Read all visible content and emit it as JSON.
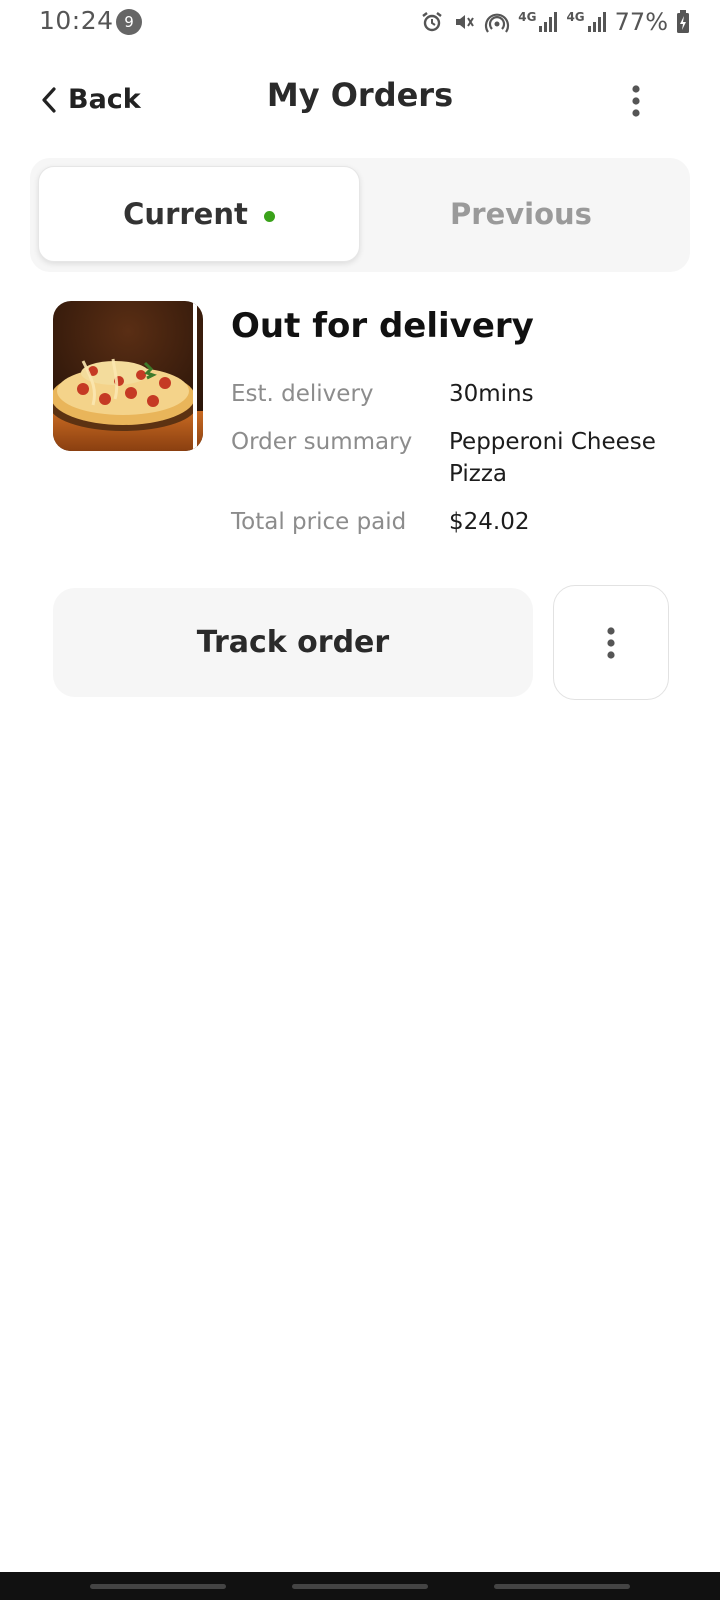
{
  "status_bar": {
    "time": "10:24",
    "notification_count": "9",
    "battery": "77%",
    "network_1": "4G",
    "network_2": "4G"
  },
  "header": {
    "back_label": "Back",
    "title": "My Orders"
  },
  "tabs": [
    {
      "label": "Current",
      "active": true
    },
    {
      "label": "Previous",
      "active": false
    }
  ],
  "order": {
    "status": "Out for delivery",
    "image_icon": "pizza-photo",
    "details": [
      {
        "label": "Est. delivery",
        "value": "30mins"
      },
      {
        "label": "Order summary",
        "value": "Pepperoni Cheese Pizza"
      },
      {
        "label": "Total price paid",
        "value": "$24.02"
      }
    ]
  },
  "actions": {
    "track_label": "Track order"
  },
  "colors": {
    "active_dot": "#3aa21a",
    "tab_bg": "#f6f6f6",
    "muted_text": "#8c8c8c"
  }
}
